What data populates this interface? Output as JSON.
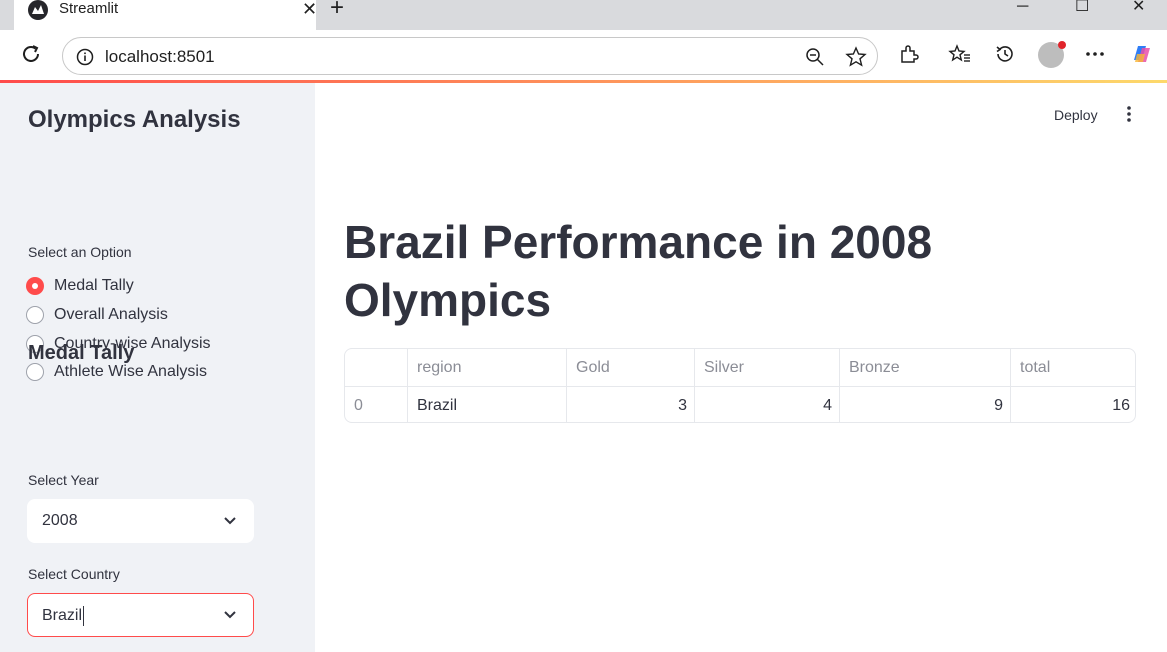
{
  "browser": {
    "tab_title": "Streamlit",
    "url": "localhost:8501"
  },
  "header": {
    "deploy_label": "Deploy"
  },
  "sidebar": {
    "title": "Olympics Analysis",
    "option_label": "Select an Option",
    "options": [
      {
        "label": "Medal Tally",
        "selected": true
      },
      {
        "label": "Overall Analysis",
        "selected": false
      },
      {
        "label": "Country-wise Analysis",
        "selected": false
      },
      {
        "label": "Athlete Wise Analysis",
        "selected": false
      }
    ],
    "section_title": "Medal Tally",
    "year_label": "Select Year",
    "year_value": "2008",
    "country_label": "Select Country",
    "country_value": "Brazil"
  },
  "main": {
    "title": "Brazil Performance in 2008 Olympics",
    "table": {
      "columns": [
        "",
        "region",
        "Gold",
        "Silver",
        "Bronze",
        "total"
      ],
      "rows": [
        [
          "0",
          "Brazil",
          "3",
          "4",
          "9",
          "16"
        ]
      ]
    }
  },
  "colors": {
    "accent": "#ff4b4b",
    "sidebar_bg": "#f0f2f6",
    "text": "#31333f"
  }
}
